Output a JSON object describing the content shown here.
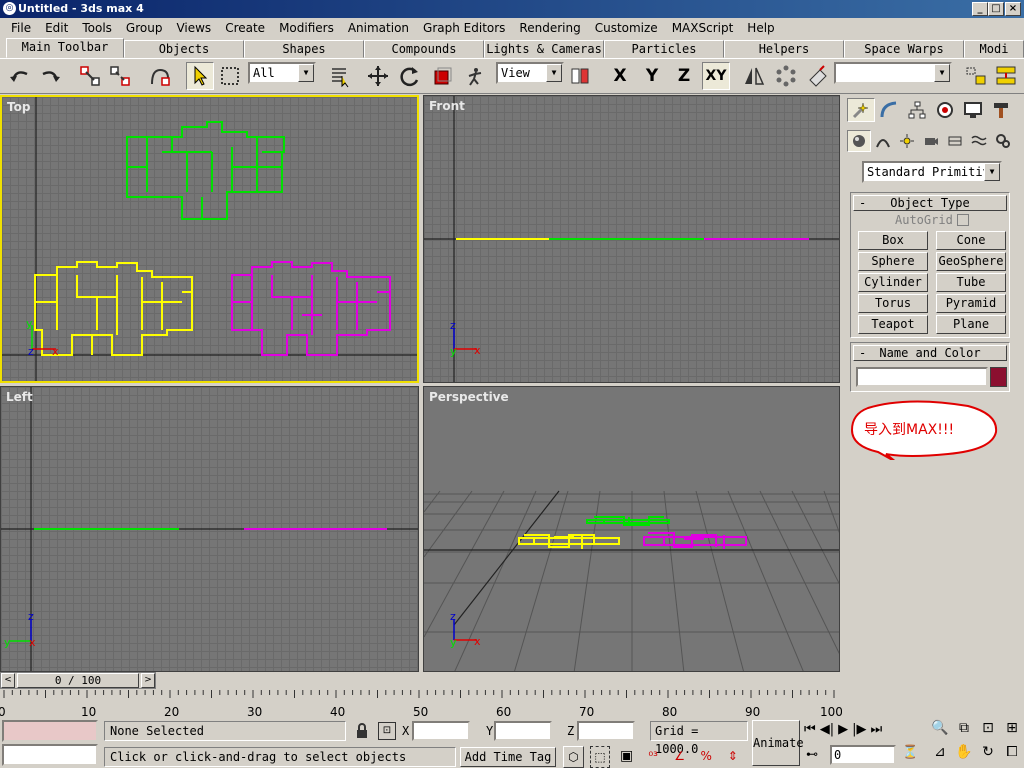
{
  "window": {
    "title": "Untitled - 3ds max 4",
    "min": "_",
    "max": "□",
    "close": "×"
  },
  "menu": [
    "File",
    "Edit",
    "Tools",
    "Group",
    "Views",
    "Create",
    "Modifiers",
    "Animation",
    "Graph Editors",
    "Rendering",
    "Customize",
    "MAXScript",
    "Help"
  ],
  "tabs": [
    "Main Toolbar",
    "Objects",
    "Shapes",
    "Compounds",
    "Lights & Cameras",
    "Particles",
    "Helpers",
    "Space Warps",
    "Modi"
  ],
  "toolbar": {
    "selection_filter": "All",
    "ref_coord": "View",
    "axis_x": "X",
    "axis_y": "Y",
    "axis_z": "Z",
    "axis_xy": "XY",
    "named_selection": ""
  },
  "viewports": {
    "top": "Top",
    "front": "Front",
    "left": "Left",
    "perspective": "Perspective"
  },
  "axis_labels": {
    "x": "x",
    "y": "y",
    "z": "z"
  },
  "command_panel": {
    "category": "Standard Primitiv",
    "object_type_title": "Object Type",
    "autogrid": "AutoGrid",
    "buttons": [
      "Box",
      "Cone",
      "Sphere",
      "GeoSphere",
      "Cylinder",
      "Tube",
      "Torus",
      "Pyramid",
      "Teapot",
      "Plane"
    ],
    "name_color_title": "Name and Color",
    "name_value": "",
    "color": "#8b0f2f",
    "collapse_marker": "-"
  },
  "annotation": "导入到MAX!!!",
  "timeline": {
    "frame": "0 / 100",
    "ticks": [
      "0",
      "10",
      "20",
      "30",
      "40",
      "50",
      "60",
      "70",
      "80",
      "90",
      "100"
    ]
  },
  "status": {
    "selection": "None Selected",
    "prompt": "Click or click-and-drag to select objects",
    "x_label": "X:",
    "y_label": "Y:",
    "z_label": "Z:",
    "grid": "Grid = 1000.0",
    "add_time_tag": "Add Time Tag",
    "animate": "Animate",
    "current_frame": "0"
  },
  "colors": {
    "green": "#00e000",
    "yellow": "#ffff00",
    "magenta": "#e000e0",
    "active_border": "#f0e000"
  }
}
